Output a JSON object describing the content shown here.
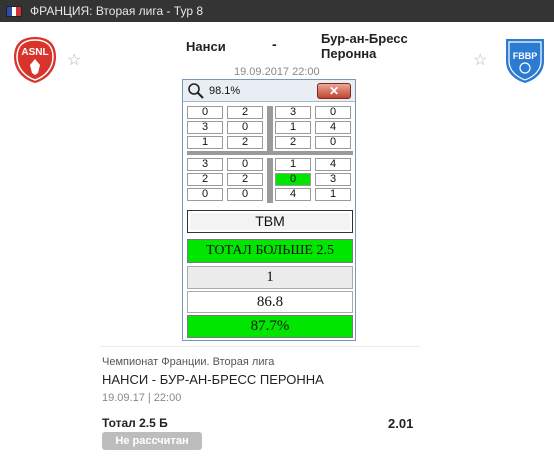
{
  "header": {
    "title": "ФРАНЦИЯ: Вторая лига - Тур 8",
    "flag_colors": [
      "#2b4fa8",
      "#ffffff",
      "#d4303a"
    ]
  },
  "match": {
    "home_team": "Нанси",
    "away_team_line1": "Бур-ан-Бресс",
    "away_team_line2": "Перонна",
    "separator": "-",
    "datetime": "19.09.2017 22:00",
    "home_logo_text": "ASNL",
    "away_logo_text": "FBBP",
    "home_logo_color": "#d9342b",
    "away_logo_color": "#2a7bd1"
  },
  "popup": {
    "zoom": "98.1%",
    "close_label": "✕",
    "matrix_top": [
      [
        "0",
        "2",
        "3",
        "0"
      ],
      [
        "3",
        "0",
        "1",
        "4"
      ],
      [
        "1",
        "2",
        "2",
        "0"
      ]
    ],
    "matrix_bottom": [
      [
        "3",
        "0",
        "1",
        "4"
      ],
      [
        "2",
        "2",
        "0",
        "3"
      ],
      [
        "0",
        "0",
        "4",
        "1"
      ]
    ],
    "highlight_color": "#00e600",
    "button_label": "ТВМ",
    "prediction": "ТОТАЛ БОЛЬШЕ 2.5",
    "value1": "1",
    "value2": "86.8",
    "value3": "87.7%"
  },
  "bet_info": {
    "league": "Чемпионат Франции. Вторая лига",
    "match_title": "НАНСИ - БУР-АН-БРЕСС ПЕРОННА",
    "date": "19.09.17 | 22:00",
    "bet_type": "Тотал 2.5 Б",
    "odds": "2.01",
    "status": "Не рассчитан"
  }
}
